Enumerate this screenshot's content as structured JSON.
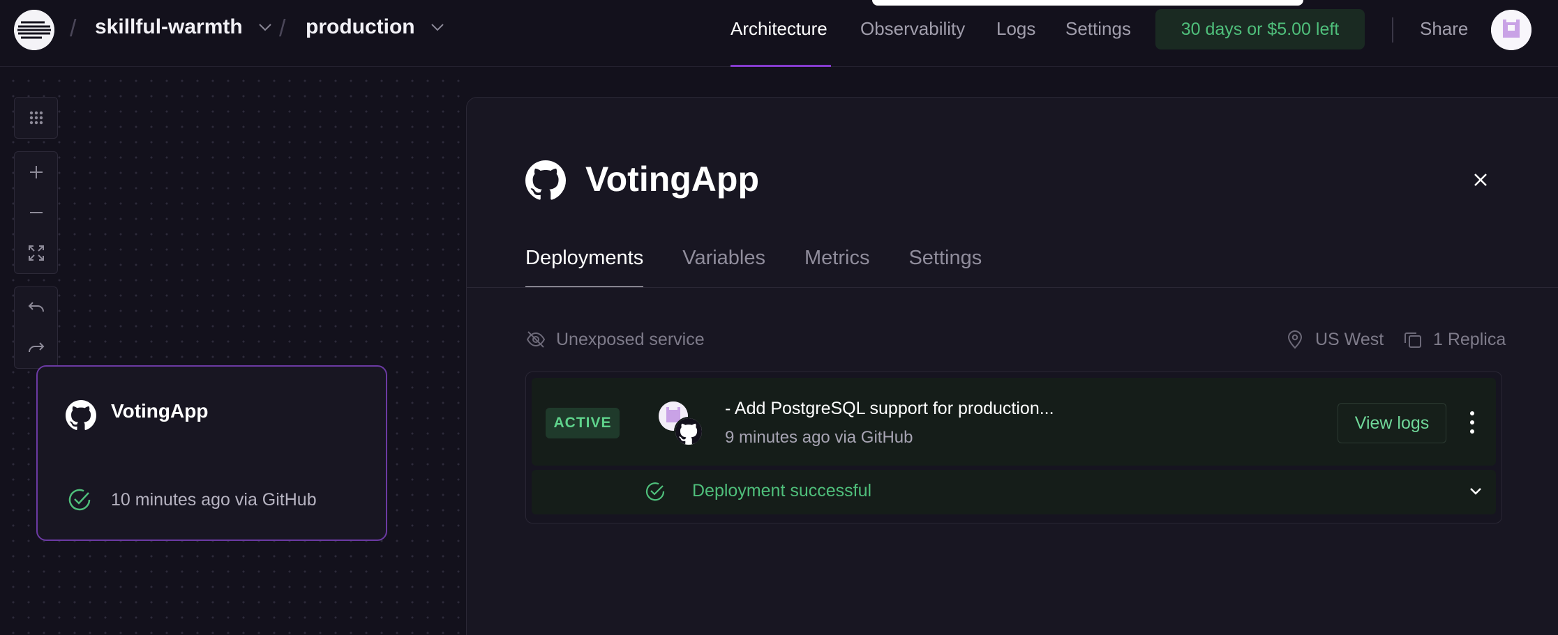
{
  "project": {
    "name": "skillful-warmth",
    "environment": "production"
  },
  "nav": {
    "items": [
      "Architecture",
      "Observability",
      "Logs",
      "Settings"
    ],
    "active": "Architecture",
    "trial": "30 days or $5.00 left",
    "share": "Share"
  },
  "canvas": {
    "service_card": {
      "name": "VotingApp",
      "status": "10 minutes ago via GitHub"
    }
  },
  "panel": {
    "title": "VotingApp",
    "tabs": [
      "Deployments",
      "Variables",
      "Metrics",
      "Settings"
    ],
    "active_tab": "Deployments",
    "exposure": "Unexposed service",
    "region": "US West",
    "replicas": "1 Replica",
    "deployment": {
      "badge": "ACTIVE",
      "commit_message": "- Add PostgreSQL support for production...",
      "time": "9 minutes ago via GitHub",
      "view_logs_label": "View logs",
      "status": "Deployment successful"
    }
  },
  "icons": [
    "railway-logo-icon",
    "chevron-down-icon",
    "grid-icon",
    "plus-icon",
    "minus-icon",
    "fit-view-icon",
    "undo-icon",
    "redo-icon",
    "github-icon",
    "check-circle-icon",
    "close-icon",
    "eye-off-icon",
    "map-pin-icon",
    "copy-icon",
    "kebab-menu-icon"
  ],
  "colors": {
    "accent": "#853bce",
    "success": "#4fbf7b",
    "background": "#13111c"
  }
}
